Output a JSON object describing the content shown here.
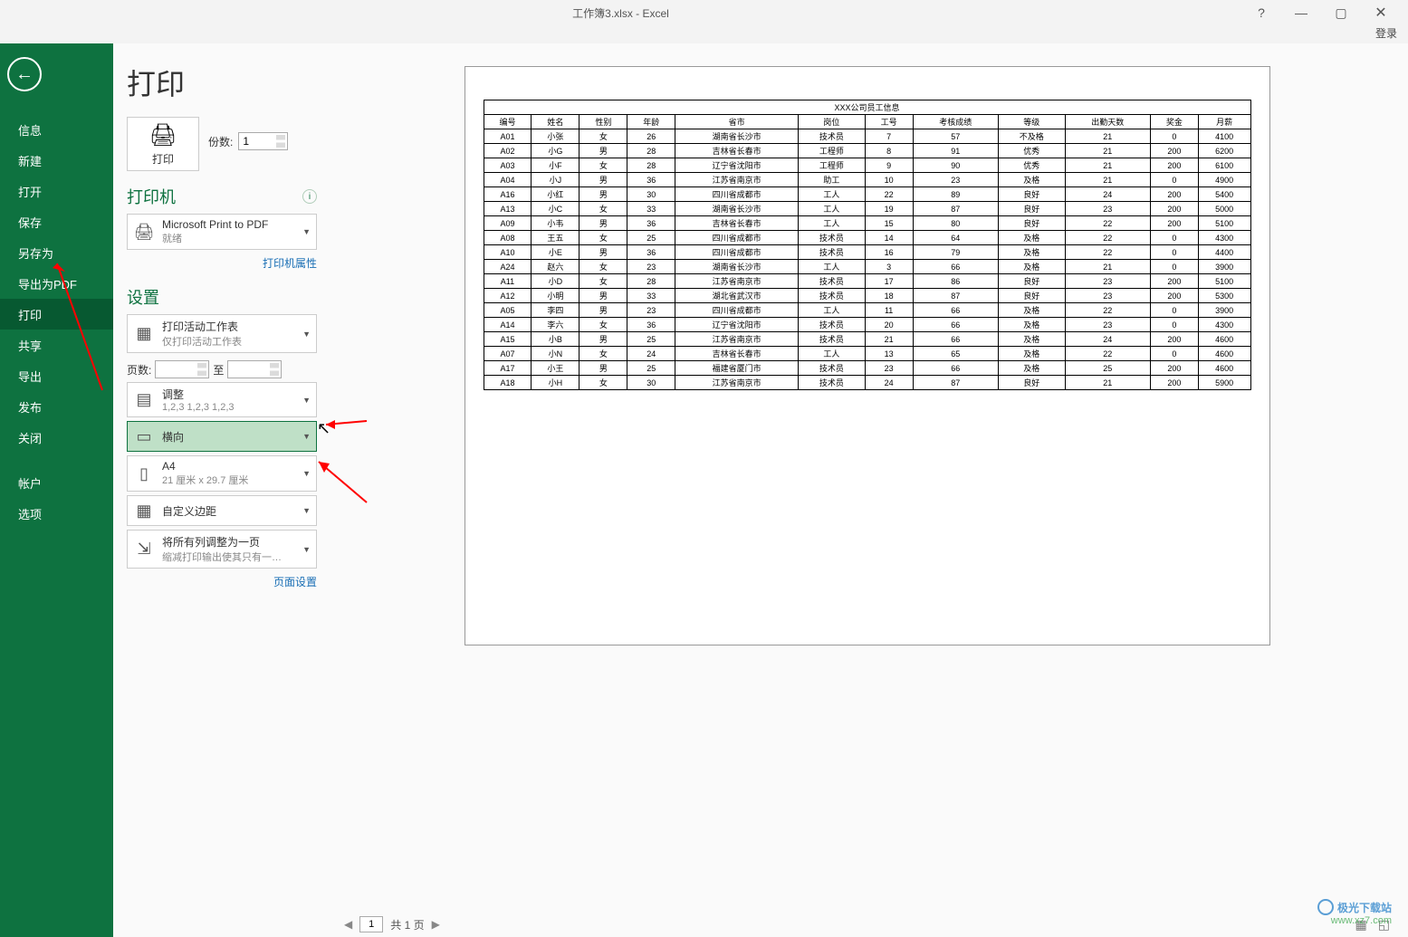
{
  "window": {
    "title": "工作簿3.xlsx - Excel",
    "login": "登录"
  },
  "sidebar": {
    "items": [
      "信息",
      "新建",
      "打开",
      "保存",
      "另存为",
      "导出为PDF",
      "打印",
      "共享",
      "导出",
      "发布",
      "关闭"
    ],
    "footer": [
      "帐户",
      "选项"
    ],
    "selected": "打印"
  },
  "panel": {
    "title": "打印",
    "print_btn": "打印",
    "copies_label": "份数:",
    "copies_value": "1",
    "printer_header": "打印机",
    "printer_name": "Microsoft Print to PDF",
    "printer_status": "就绪",
    "printer_link": "打印机属性",
    "settings_header": "设置",
    "scope_title": "打印活动工作表",
    "scope_subtitle": "仅打印活动工作表",
    "page_label": "页数:",
    "page_to": "至",
    "collate_title": "调整",
    "collate_subtitle": "1,2,3    1,2,3    1,2,3",
    "orientation": "横向",
    "paper_title": "A4",
    "paper_subtitle": "21 厘米 x 29.7 厘米",
    "margins": "自定义边距",
    "scale_title": "将所有列调整为一页",
    "scale_subtitle": "缩减打印输出使其只有一…",
    "page_setup_link": "页面设置"
  },
  "table": {
    "title": "XXX公司员工信息",
    "headers": [
      "编号",
      "姓名",
      "性别",
      "年龄",
      "省市",
      "岗位",
      "工号",
      "考核成绩",
      "等级",
      "出勤天数",
      "奖金",
      "月薪"
    ],
    "rows": [
      [
        "A01",
        "小张",
        "女",
        "26",
        "湖南省长沙市",
        "技术员",
        "7",
        "57",
        "不及格",
        "21",
        "0",
        "4100"
      ],
      [
        "A02",
        "小G",
        "男",
        "28",
        "吉林省长春市",
        "工程师",
        "8",
        "91",
        "优秀",
        "21",
        "200",
        "6200"
      ],
      [
        "A03",
        "小F",
        "女",
        "28",
        "辽宁省沈阳市",
        "工程师",
        "9",
        "90",
        "优秀",
        "21",
        "200",
        "6100"
      ],
      [
        "A04",
        "小J",
        "男",
        "36",
        "江苏省南京市",
        "助工",
        "10",
        "23",
        "及格",
        "21",
        "0",
        "4900"
      ],
      [
        "A16",
        "小红",
        "男",
        "30",
        "四川省成都市",
        "工人",
        "22",
        "89",
        "良好",
        "24",
        "200",
        "5400"
      ],
      [
        "A13",
        "小C",
        "女",
        "33",
        "湖南省长沙市",
        "工人",
        "19",
        "87",
        "良好",
        "23",
        "200",
        "5000"
      ],
      [
        "A09",
        "小韦",
        "男",
        "36",
        "吉林省长春市",
        "工人",
        "15",
        "80",
        "良好",
        "22",
        "200",
        "5100"
      ],
      [
        "A08",
        "王五",
        "女",
        "25",
        "四川省成都市",
        "技术员",
        "14",
        "64",
        "及格",
        "22",
        "0",
        "4300"
      ],
      [
        "A10",
        "小E",
        "男",
        "36",
        "四川省成都市",
        "技术员",
        "16",
        "79",
        "及格",
        "22",
        "0",
        "4400"
      ],
      [
        "A24",
        "赵六",
        "女",
        "23",
        "湖南省长沙市",
        "工人",
        "3",
        "66",
        "及格",
        "21",
        "0",
        "3900"
      ],
      [
        "A11",
        "小D",
        "女",
        "28",
        "江苏省南京市",
        "技术员",
        "17",
        "86",
        "良好",
        "23",
        "200",
        "5100"
      ],
      [
        "A12",
        "小明",
        "男",
        "33",
        "湖北省武汉市",
        "技术员",
        "18",
        "87",
        "良好",
        "23",
        "200",
        "5300"
      ],
      [
        "A05",
        "李四",
        "男",
        "23",
        "四川省成都市",
        "工人",
        "11",
        "66",
        "及格",
        "22",
        "0",
        "3900"
      ],
      [
        "A14",
        "李六",
        "女",
        "36",
        "辽宁省沈阳市",
        "技术员",
        "20",
        "66",
        "及格",
        "23",
        "0",
        "4300"
      ],
      [
        "A15",
        "小B",
        "男",
        "25",
        "江苏省南京市",
        "技术员",
        "21",
        "66",
        "及格",
        "24",
        "200",
        "4600"
      ],
      [
        "A07",
        "小N",
        "女",
        "24",
        "吉林省长春市",
        "工人",
        "13",
        "65",
        "及格",
        "22",
        "0",
        "4600"
      ],
      [
        "A17",
        "小王",
        "男",
        "25",
        "福建省厦门市",
        "技术员",
        "23",
        "66",
        "及格",
        "25",
        "200",
        "4600"
      ],
      [
        "A18",
        "小H",
        "女",
        "30",
        "江苏省南京市",
        "技术员",
        "24",
        "87",
        "良好",
        "21",
        "200",
        "5900"
      ]
    ]
  },
  "nav": {
    "page_current": "1",
    "page_total_label": "共 1 页"
  },
  "watermark": {
    "title": "极光下载站",
    "url": "www.xz7.com"
  }
}
